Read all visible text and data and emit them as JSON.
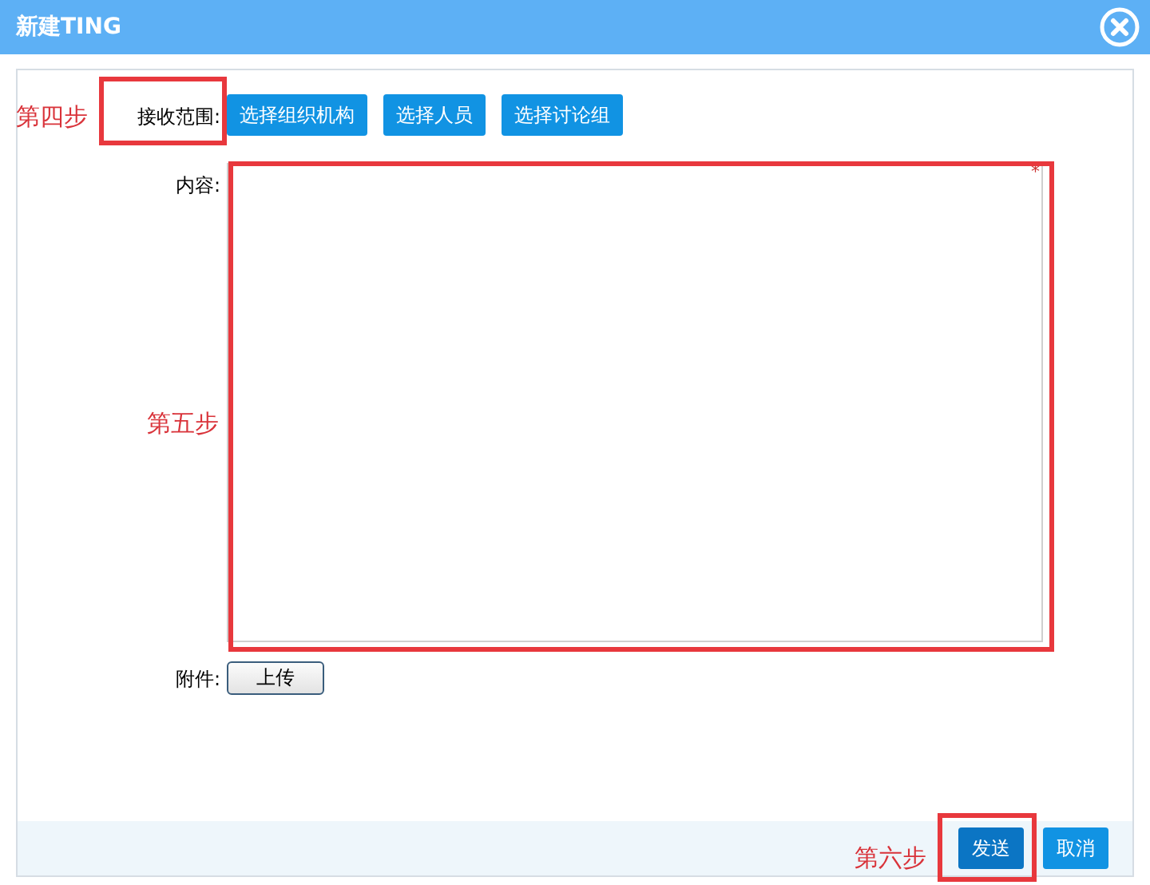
{
  "window": {
    "title": "新建TING"
  },
  "recipient": {
    "label": "接收范围:",
    "buttons": [
      "选择组织机构",
      "选择人员",
      "选择讨论组"
    ]
  },
  "content": {
    "label": "内容:",
    "required_mark": "*"
  },
  "attachment": {
    "label": "附件:",
    "button": "上传"
  },
  "footer": {
    "buttons": [
      {
        "label": "发送",
        "kind": "primary"
      },
      {
        "label": "取消",
        "kind": "secondary"
      }
    ]
  },
  "annotations": [
    {
      "label": "第四步"
    },
    {
      "label": "第五步"
    },
    {
      "label": "第六步"
    }
  ]
}
